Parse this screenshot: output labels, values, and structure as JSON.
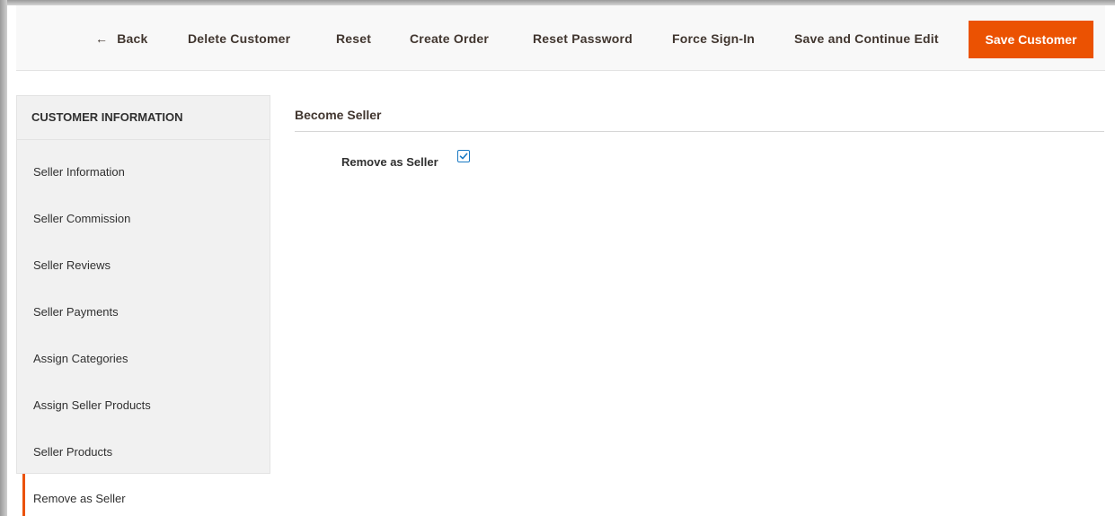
{
  "toolbar": {
    "back_arrow": "←",
    "back_label": "Back",
    "delete_label": "Delete Customer",
    "reset_label": "Reset",
    "create_order_label": "Create Order",
    "reset_password_label": "Reset Password",
    "force_signin_label": "Force Sign-In",
    "save_continue_label": "Save and Continue Edit",
    "save_label": "Save Customer"
  },
  "sidebar": {
    "title": "CUSTOMER INFORMATION",
    "items": [
      {
        "label": "Seller Information"
      },
      {
        "label": "Seller Commission"
      },
      {
        "label": "Seller Reviews"
      },
      {
        "label": "Seller Payments"
      },
      {
        "label": "Assign Categories"
      },
      {
        "label": "Assign Seller Products"
      },
      {
        "label": "Seller Products"
      }
    ],
    "active_item": "Remove as Seller"
  },
  "main": {
    "section_title": "Become Seller",
    "field_label": "Remove as Seller",
    "checkbox_checked": true
  },
  "colors": {
    "accent": "#eb5202",
    "checkbox_border": "#1979c3"
  }
}
